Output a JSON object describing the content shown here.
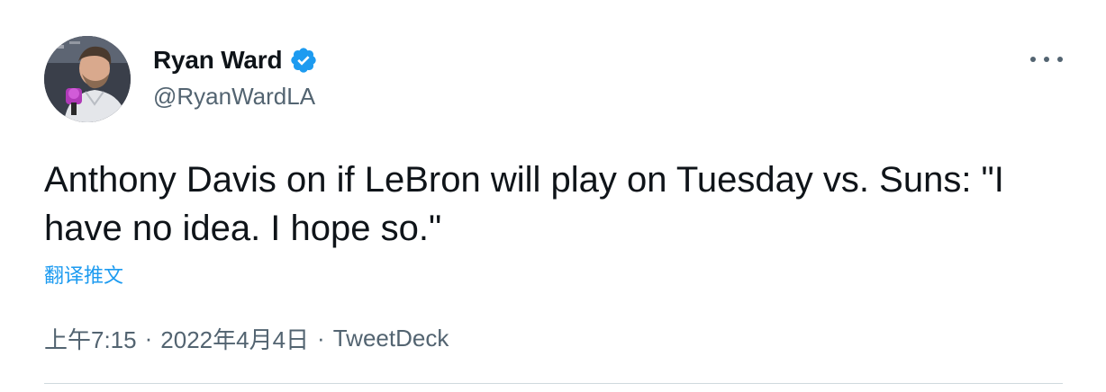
{
  "author": {
    "display_name": "Ryan Ward",
    "handle": "@RyanWardLA",
    "verified": true,
    "avatar_icon": "profile-photo"
  },
  "tweet": {
    "text": "Anthony Davis on if LeBron will play on Tuesday vs. Suns: \"I have no idea. I hope so.\"",
    "translate_label": "翻译推文",
    "time": "上午7:15",
    "date": "2022年4月4日",
    "source": "TweetDeck",
    "separator": "·"
  },
  "icons": {
    "more": "more-horizontal-icon",
    "verified": "verified-badge-icon"
  },
  "colors": {
    "accent": "#1d9bf0",
    "text_primary": "#0f1419",
    "text_secondary": "#536471",
    "divider": "#cfd9de"
  }
}
